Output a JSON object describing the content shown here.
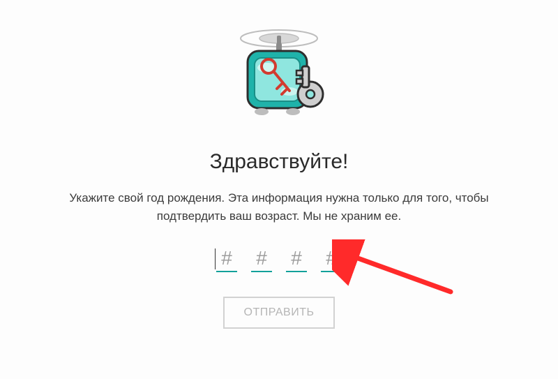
{
  "heading": "Здравствуйте!",
  "subtext": "Укажите свой год рождения. Эта информация нужна только для того, чтобы подтвердить ваш возраст. Мы не храним ее.",
  "digits": {
    "placeholder": "#"
  },
  "submit_label": "ОТПРАВИТЬ",
  "illustration": {
    "name": "lock-key-propeller-icon"
  },
  "colors": {
    "accent": "#12a19a",
    "arrow": "#ff2a2a"
  }
}
